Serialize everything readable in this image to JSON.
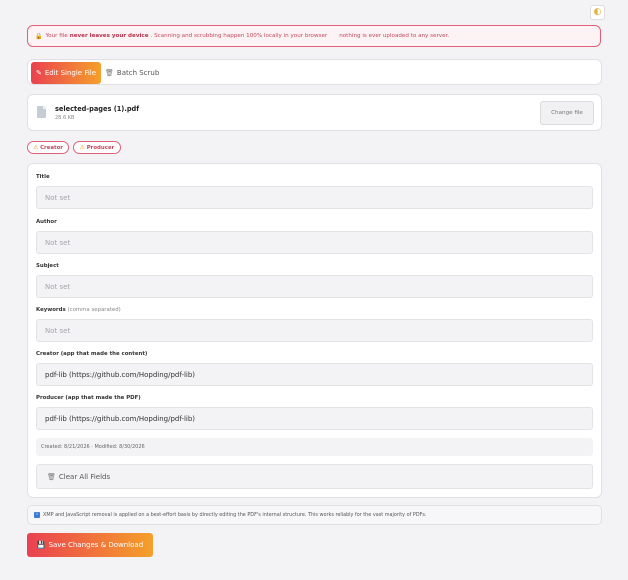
{
  "privacy_banner": {
    "lead": "Your file",
    "strong": "never leaves your device",
    "rest": ". Scanning and scrubbing happen 100% locally in your browser",
    "tail": "nothing is ever uploaded to any server."
  },
  "mode_tabs": {
    "single": "Edit Single File",
    "batch": "Batch Scrub"
  },
  "file": {
    "name": "selected-pages (1).pdf",
    "size": "28.6 KB",
    "change_label": "Change file"
  },
  "badges": [
    "Creator",
    "Producer"
  ],
  "fields": {
    "title": {
      "label": "Title",
      "placeholder": "Not set",
      "value": ""
    },
    "author": {
      "label": "Author",
      "placeholder": "Not set",
      "value": ""
    },
    "subject": {
      "label": "Subject",
      "placeholder": "Not set",
      "value": ""
    },
    "keywords": {
      "label": "Keywords",
      "hint": "(comma separated)",
      "placeholder": "Not set",
      "value": ""
    },
    "creator": {
      "label": "Creator (app that made the content)",
      "value": "pdf-lib (https://github.com/Hopding/pdf-lib)"
    },
    "producer": {
      "label": "Producer (app that made the PDF)",
      "value": "pdf-lib (https://github.com/Hopding/pdf-lib)"
    }
  },
  "dates": "Created: 8/21/2026 · Modified: 8/30/2026",
  "clear_label": "Clear All Fields",
  "note": "XMP and JavaScript removal is applied on a best-effort basis by directly editing the PDF's internal structure. This works reliably for the vast majority of PDFs.",
  "save_label": "Save Changes & Download",
  "colors": {
    "accent_start": "#ea4150",
    "accent_end": "#f5a02a",
    "warning_border": "#e0607a"
  }
}
